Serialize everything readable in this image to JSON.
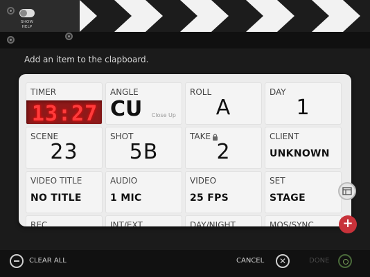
{
  "help": {
    "label": "SHOW HELP"
  },
  "instruction": "Add an item to the clapboard.",
  "fields": [
    {
      "label": "TIMER",
      "value": "13:27"
    },
    {
      "label": "ANGLE",
      "value": "CU",
      "sub": "Close Up"
    },
    {
      "label": "ROLL",
      "value": "A"
    },
    {
      "label": "DAY",
      "value": "1"
    },
    {
      "label": "SCENE",
      "value": "23"
    },
    {
      "label": "SHOT",
      "value": "5B"
    },
    {
      "label": "TAKE",
      "value": "2"
    },
    {
      "label": "CLIENT",
      "value": "UNKNOWN"
    },
    {
      "label": "VIDEO TITLE",
      "value": "NO TITLE"
    },
    {
      "label": "AUDIO",
      "value": "1 MIC"
    },
    {
      "label": "VIDEO",
      "value": "25 FPS"
    },
    {
      "label": "SET",
      "value": "STAGE"
    },
    {
      "label": "REC",
      "value": ""
    },
    {
      "label": "INT/EXT",
      "value": ""
    },
    {
      "label": "DAY/NIGHT",
      "value": ""
    },
    {
      "label": "MOS/SYNC",
      "value": ""
    }
  ],
  "bottom": {
    "clear_all": "CLEAR ALL",
    "cancel": "CANCEL",
    "done": "DONE"
  },
  "colors": {
    "led_text": "#ff3b3b",
    "led_bg": "#8e1a1a",
    "add_button": "#c8323a"
  }
}
